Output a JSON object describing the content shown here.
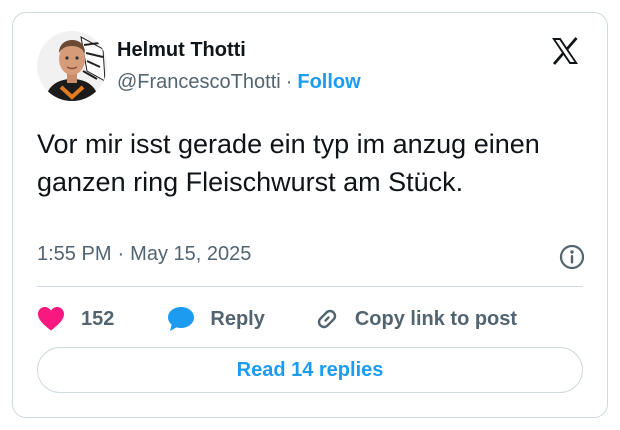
{
  "author": {
    "display_name": "Helmut Thotti",
    "handle": "@FrancescoThotti",
    "separator": "·",
    "follow_label": "Follow"
  },
  "tweet": {
    "text": "Vor mir isst gerade ein typ im anzug einen ganzen ring Fleischwurst am Stück.",
    "time": "1:55 PM",
    "date_separator": "·",
    "date": "May 15, 2025"
  },
  "actions": {
    "like_count": "152",
    "reply_label": "Reply",
    "copy_link_label": "Copy link to post"
  },
  "read_replies_label": "Read 14 replies",
  "colors": {
    "accent": "#1d9bf0",
    "like": "#f91880",
    "secondary_text": "#536471",
    "border": "#cfd9de"
  },
  "icons": [
    "x-logo-icon",
    "info-icon",
    "heart-icon",
    "reply-bubble-icon",
    "link-icon"
  ]
}
